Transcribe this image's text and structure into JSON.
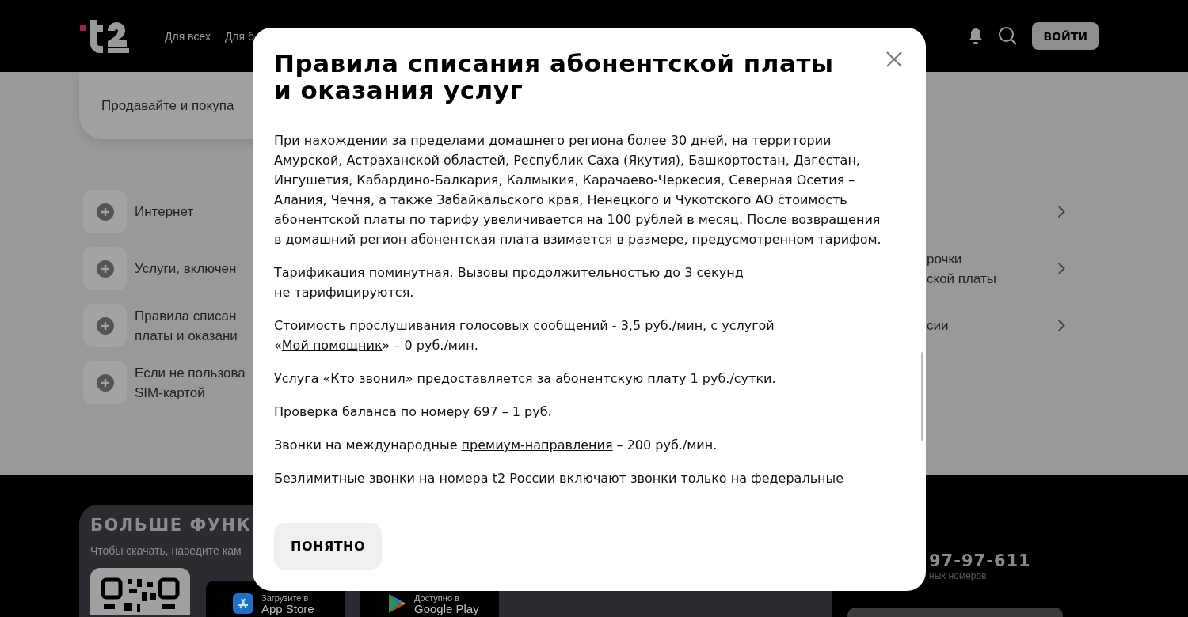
{
  "header": {
    "nav": [
      "Для всех",
      "Для б"
    ],
    "login_button": "ВОЙТИ"
  },
  "promo_card": {
    "text": "Продавайте и покупа"
  },
  "left_items": [
    {
      "lines": [
        "Интернет"
      ]
    },
    {
      "lines": [
        "Услуги, включен"
      ]
    },
    {
      "lines": [
        "Правила списан",
        "платы и оказани"
      ]
    },
    {
      "lines": [
        "Если не пользова",
        "SIM-картой"
      ]
    }
  ],
  "right_items": [
    {
      "chevron": true
    },
    {
      "lines": [
        "рочки",
        "ской платы"
      ],
      "chevron": true
    },
    {
      "lines": [
        "сии"
      ],
      "chevron": true
    }
  ],
  "footer": {
    "title": "БОЛЬШЕ ФУНК",
    "subtitle": "Чтобы скачать, наведите кам",
    "stores": [
      {
        "kind": "apple",
        "caption": "Загрузите в",
        "name": "App Store"
      },
      {
        "kind": "google",
        "caption": "Доступно в",
        "name": "Google Play"
      }
    ],
    "phone": "97-97-611",
    "phone_note": "ных номеров"
  },
  "modal": {
    "title": "Правила списания абонентской платы и оказания услуг",
    "paragraphs": [
      {
        "parts": [
          {
            "kind": "text",
            "text": "При нахождении за пределами домашнего региона более 30 дней, на территории Амурской, Астраханской областей, Республик Саха (Якутия), Башкортостан, Дагестан, Ингушетия, Кабардино-Балкария, Калмыкия, Карачаево-Черкесия, Северная Осетия – Алания, Чечня, а также Забайкальского края, Ненецкого и Чукотского АО стоимость абонентской платы по тарифу увеличивается на 100 рублей в месяц. После возвращения в домашний регион абонентская плата взимается в размере, предусмотренном тарифом."
          }
        ]
      },
      {
        "parts": [
          {
            "kind": "text",
            "text": "Тарификация поминутная. Вызовы продолжительностью до 3 секунд\nне тарифицируются."
          }
        ]
      },
      {
        "parts": [
          {
            "kind": "text",
            "text": "Стоимость прослушивания голосовых сообщений - 3,5 руб./мин, с услугой «"
          },
          {
            "kind": "link",
            "text": "Мой помощник"
          },
          {
            "kind": "text",
            "text": "» – 0 руб./мин."
          }
        ]
      },
      {
        "parts": [
          {
            "kind": "text",
            "text": "Услуга «"
          },
          {
            "kind": "link",
            "text": "Кто звонил"
          },
          {
            "kind": "text",
            "text": "» предоставляется за абонентскую плату 1 руб./сутки."
          }
        ]
      },
      {
        "parts": [
          {
            "kind": "text",
            "text": "Проверка баланса по номеру 697 – 1 руб."
          }
        ]
      },
      {
        "parts": [
          {
            "kind": "text",
            "text": "Звонки на международные "
          },
          {
            "kind": "link",
            "text": "премиум-направления"
          },
          {
            "kind": "text",
            "text": " – 200 руб./мин."
          }
        ]
      },
      {
        "parts": [
          {
            "kind": "text",
            "text": "Безлимитные звонки на номера t2 России включают звонки только на федеральные"
          }
        ]
      }
    ],
    "ok_button": "ПОНЯТНО"
  }
}
